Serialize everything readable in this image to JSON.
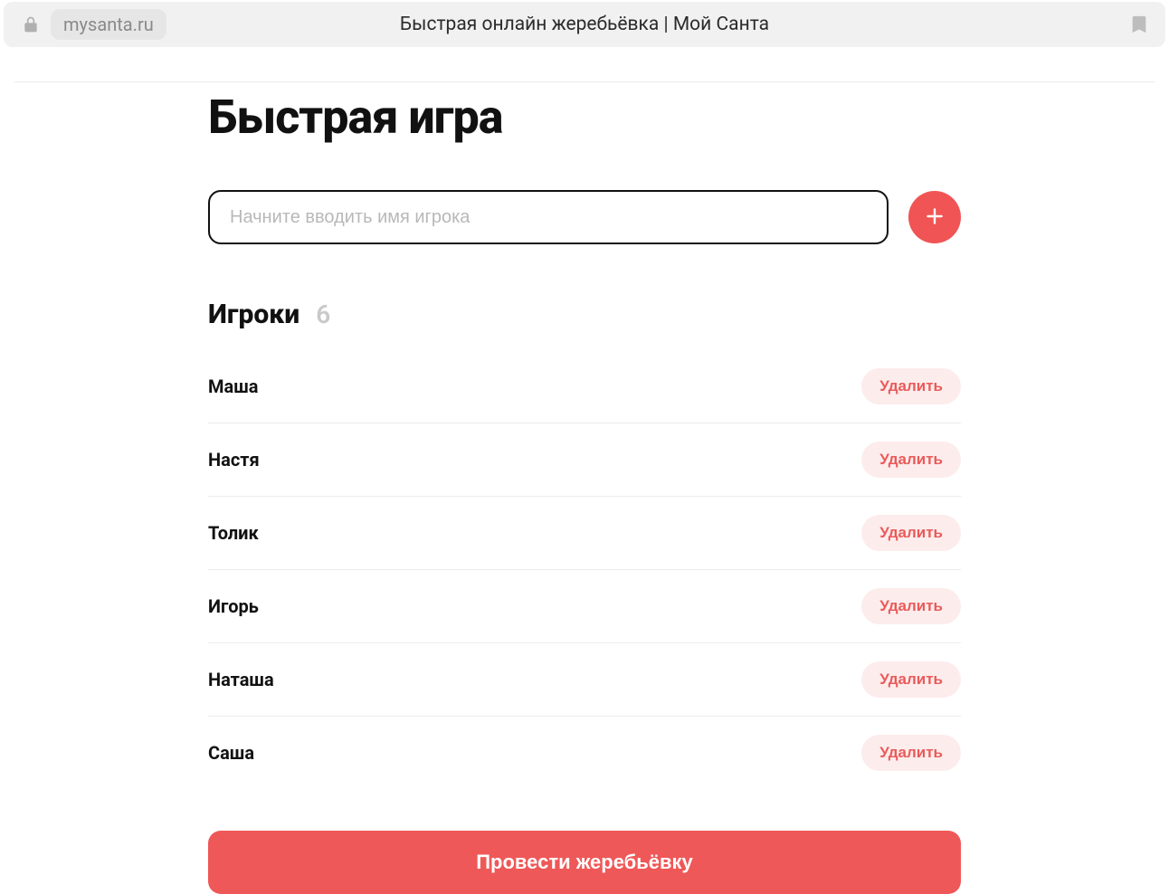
{
  "browser": {
    "domain": "mysanta.ru",
    "title": "Быстрая онлайн жеребьёвка | Мой Санта"
  },
  "page": {
    "heading": "Быстрая игра",
    "input_placeholder": "Начните вводить имя игрока",
    "players_label": "Игроки",
    "players_count": "6",
    "delete_label": "Удалить",
    "cta_label": "Провести жеребьёвку"
  },
  "players": [
    {
      "name": "Маша"
    },
    {
      "name": "Настя"
    },
    {
      "name": "Толик"
    },
    {
      "name": "Игорь"
    },
    {
      "name": "Наташа"
    },
    {
      "name": "Саша"
    }
  ]
}
